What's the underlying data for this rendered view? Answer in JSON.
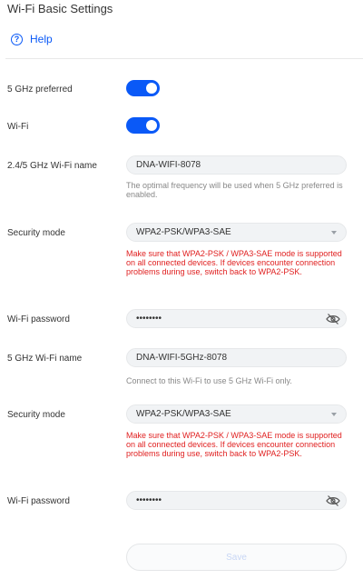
{
  "page": {
    "title": "Wi-Fi Basic Settings",
    "help_label": "Help"
  },
  "band_pref": {
    "label": "5 GHz preferred",
    "enabled": true
  },
  "wifi_toggle": {
    "label": "Wi-Fi",
    "enabled": true
  },
  "name_24": {
    "label": "2.4/5 GHz Wi-Fi name",
    "value": "DNA-WIFI-8078",
    "note": "The optimal frequency will be used when 5 GHz preferred is enabled."
  },
  "security_1": {
    "label": "Security mode",
    "value": "WPA2-PSK/WPA3-SAE",
    "warning": "Make sure that WPA2-PSK / WPA3-SAE mode is supported on all connected devices. If devices encounter connection problems during use, switch back to WPA2-PSK."
  },
  "password_1": {
    "label": "Wi-Fi password",
    "value": "••••••••"
  },
  "name_5": {
    "label": "5 GHz Wi-Fi name",
    "value": "DNA-WIFI-5GHz-8078",
    "note": "Connect to this Wi-Fi to use 5 GHz Wi-Fi only."
  },
  "security_2": {
    "label": "Security mode",
    "value": "WPA2-PSK/WPA3-SAE",
    "warning": "Make sure that WPA2-PSK / WPA3-SAE mode is supported on all connected devices. If devices encounter connection problems during use, switch back to WPA2-PSK."
  },
  "password_2": {
    "label": "Wi-Fi password",
    "value": "••••••••"
  },
  "actions": {
    "save_label": "Save"
  },
  "colors": {
    "accent": "#0a59f7",
    "warning": "#e02020"
  }
}
